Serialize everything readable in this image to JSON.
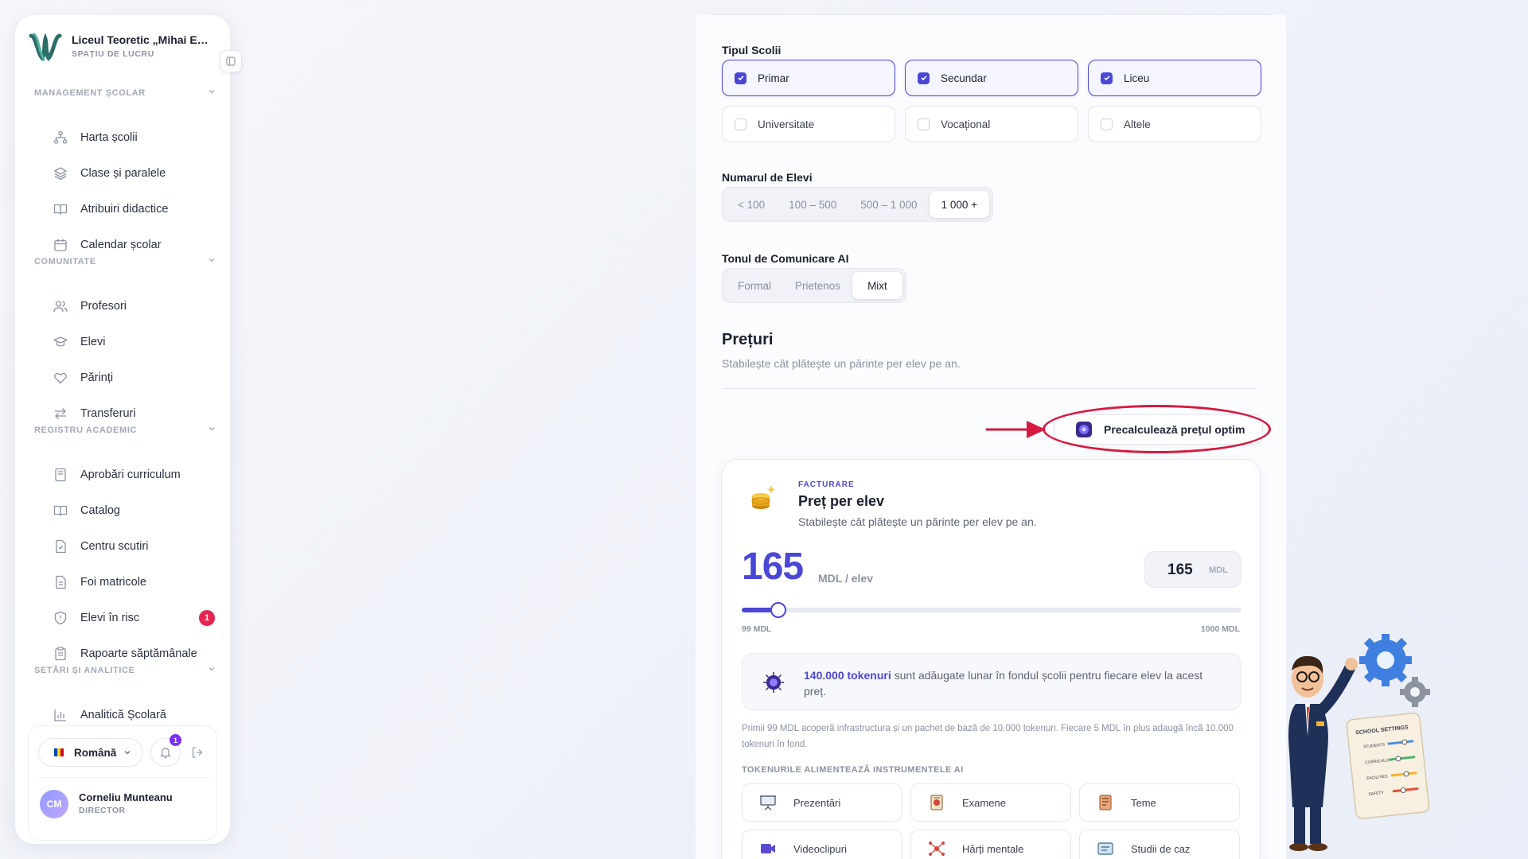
{
  "sidebar": {
    "org_name": "Liceul Teoretic „Mihai Eminescu”",
    "org_sub": "SPAȚIU DE LUCRU",
    "sections": [
      {
        "title": "MANAGEMENT ȘCOLAR"
      },
      {
        "title": "COMUNITATE"
      },
      {
        "title": "REGISTRU ACADEMIC"
      },
      {
        "title": "SETĂRI ȘI ANALITICE"
      }
    ],
    "items": [
      {
        "label": "Harta școlii",
        "icon": "sitemap-icon"
      },
      {
        "label": "Clase și paralele",
        "icon": "layers-icon"
      },
      {
        "label": "Atribuiri didactice",
        "icon": "book-open-icon"
      },
      {
        "label": "Calendar școlar",
        "icon": "calendar-icon"
      },
      {
        "label": "Profesori",
        "icon": "users-icon"
      },
      {
        "label": "Elevi",
        "icon": "graduation-cap-icon"
      },
      {
        "label": "Părinți",
        "icon": "heart-icon"
      },
      {
        "label": "Transferuri",
        "icon": "arrows-swap-icon"
      },
      {
        "label": "Aprobări curriculum",
        "icon": "book-check-icon"
      },
      {
        "label": "Catalog",
        "icon": "book-open-icon"
      },
      {
        "label": "Centru scutiri",
        "icon": "file-icon"
      },
      {
        "label": "Foi matricole",
        "icon": "file-text-icon"
      },
      {
        "label": "Elevi în risc",
        "icon": "shield-icon",
        "badge": "1"
      },
      {
        "label": "Rapoarte săptămânale",
        "icon": "clipboard-icon"
      },
      {
        "label": "Analitică Școlară",
        "icon": "bar-chart-icon"
      }
    ],
    "footer": {
      "language": "Română",
      "notif_count": "1",
      "user_initials": "CM",
      "user_name": "Corneliu Munteanu",
      "user_role": "DIRECTOR"
    }
  },
  "form": {
    "school_type": {
      "label": "Tipul Scolii",
      "options": [
        {
          "label": "Primar",
          "checked": true
        },
        {
          "label": "Secundar",
          "checked": true
        },
        {
          "label": "Liceu",
          "checked": true
        },
        {
          "label": "Universitate",
          "checked": false
        },
        {
          "label": "Vocațional",
          "checked": false
        },
        {
          "label": "Altele",
          "checked": false
        }
      ]
    },
    "students": {
      "label": "Numarul de Elevi",
      "options": [
        "< 100",
        "100 – 500",
        "500 – 1 000",
        "1 000 +"
      ],
      "selected": "1 000 +"
    },
    "tone": {
      "label": "Tonul de Comunicare AI",
      "options": [
        "Formal",
        "Prietenos",
        "Mixt"
      ],
      "selected": "Mixt"
    }
  },
  "prices": {
    "title": "Prețuri",
    "subtitle": "Stabilește cât plătește un părinte per elev pe an.",
    "precalc_button": "Precalculează prețul optim"
  },
  "card": {
    "kicker": "FACTURARE",
    "title": "Preț per elev",
    "subtitle": "Stabilește cât plătește un părinte per elev pe an.",
    "price": "165",
    "price_unit": "MDL / elev",
    "input_value": "165",
    "input_unit": "MDL",
    "slider_min": "99 MDL",
    "slider_max": "1000 MDL",
    "slider_value": 165,
    "slider_range": [
      99,
      1000
    ],
    "tokens_bold": "140.000 tokenuri",
    "tokens_text": " sunt adăugate lunar în fondul școlii pentru fiecare elev la acest preț.",
    "fineprint": "Primii 99 MDL acoperă infrastructura și un pachet de bază de 10.000 tokenuri. Fiecare 5 MDL în plus adaugă încă 10.000 tokenuri în fond.",
    "tools_title": "TOKENURILE ALIMENTEAZĂ INSTRUMENTELE AI",
    "tools": [
      {
        "label": "Prezentări",
        "icon": "presentation-icon"
      },
      {
        "label": "Examene",
        "icon": "exam-icon"
      },
      {
        "label": "Teme",
        "icon": "notebook-icon"
      },
      {
        "label": "Videoclipuri",
        "icon": "video-icon"
      },
      {
        "label": "Hărți mentale",
        "icon": "mindmap-icon"
      },
      {
        "label": "Studii de caz",
        "icon": "case-study-icon"
      }
    ]
  },
  "mascot": {
    "board_title": "SCHOOL SETTINGS",
    "board_rows": [
      "STUDENTS",
      "CURRICULUM",
      "FACILITIES",
      "SAFETY"
    ]
  },
  "colors": {
    "accent": "#4b47d6",
    "highlight": "#d6193f",
    "badge_red": "#e5254f"
  }
}
